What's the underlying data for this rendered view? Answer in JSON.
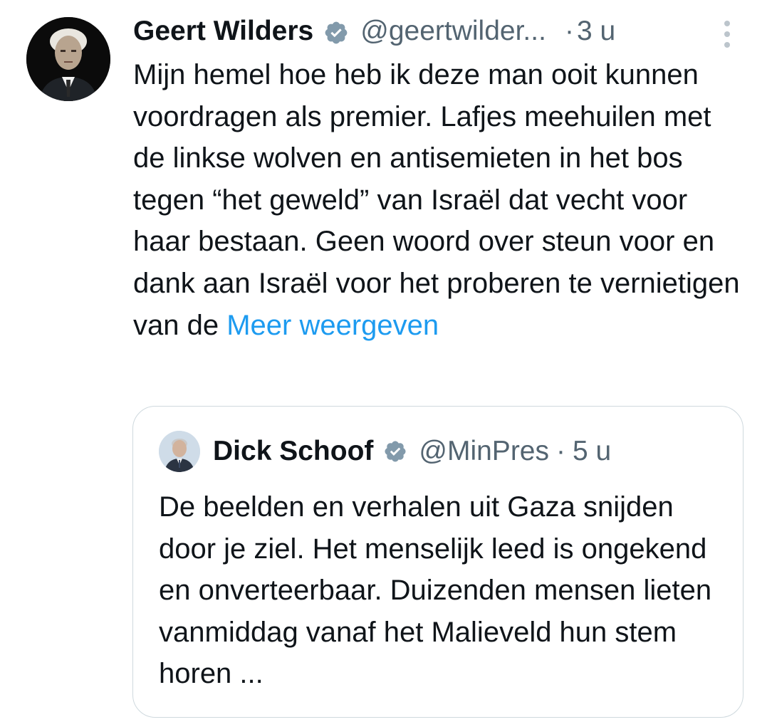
{
  "tweet": {
    "author_name": "Geert Wilders",
    "handle": "@geertwilder...",
    "separator": "·",
    "time": "3 u",
    "body": "Mijn hemel hoe heb ik deze man ooit kunnen voordragen als premier. Lafjes meehuilen met de linkse wolven en antisemieten in het bos tegen “het geweld” van Israël dat vecht voor haar bestaan. Geen woord over steun voor en dank aan Israël voor het proberen te vernietigen van de ",
    "show_more": "Meer weergeven"
  },
  "quoted_tweet": {
    "author_name": "Dick Schoof",
    "handle": "@MinPres",
    "separator": "·",
    "time": "5 u",
    "body": "De beelden en verhalen uit Gaza snijden door je ziel. Het menselijk leed is ongekend en onverteerbaar. Duizenden mensen lieten vanmiddag vanaf het Malieveld hun stem horen ..."
  },
  "icons": {
    "verified": "verified-badge-icon",
    "more": "more-options-icon"
  },
  "colors": {
    "text": "#0f1419",
    "secondary": "#536471",
    "link": "#1d9bf0",
    "badge": "#829aab",
    "border": "#cfd9de"
  }
}
